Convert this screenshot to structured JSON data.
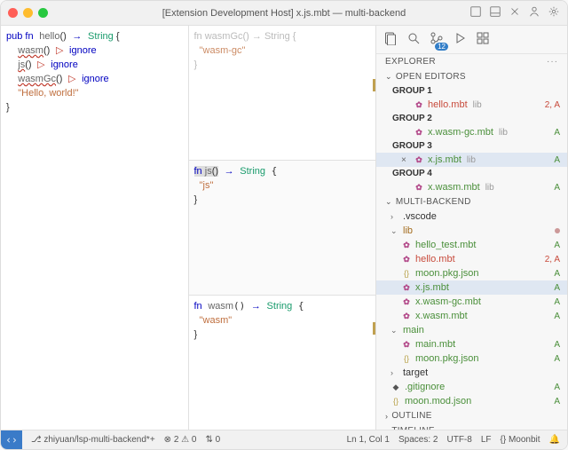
{
  "title": "[Extension Development Host] x.js.mbt — multi-backend",
  "editor_left": {
    "line1_kw": "pub fn",
    "line1_name": "hello",
    "line1_paren": "()",
    "line1_arrow": "→",
    "line1_type": "String",
    "line1_brace": " {",
    "line2_call": "wasm",
    "line2_paren": "()",
    "line2_op": "▷",
    "line2_ignore": "ignore",
    "line3_call": "js",
    "line3_paren": "()",
    "line3_op": "▷",
    "line3_ignore": "ignore",
    "line4_call": "wasmGc",
    "line4_paren": "()",
    "line4_op": "▷",
    "line4_ignore": "ignore",
    "line5_str": "\"Hello, world!\"",
    "line6_brace": "}"
  },
  "pane_gc": {
    "sig": "fn wasmGc() → String {",
    "body": "  \"wasm-gc\"",
    "close": "}"
  },
  "pane_js": {
    "sig": "fn js() → String {",
    "body": "  \"js\"",
    "close": "}"
  },
  "pane_wasm": {
    "sig": "fn wasm() → String {",
    "body": "  \"wasm\"",
    "close": "}"
  },
  "sidebar": {
    "explorer": "EXPLORER",
    "open_editors": "OPEN EDITORS",
    "groups": [
      {
        "name": "GROUP 1",
        "file": "hello.mbt",
        "suffix": "lib",
        "badge": "2, A",
        "kind": "error",
        "icon": "mbt"
      },
      {
        "name": "GROUP 2",
        "file": "x.wasm-gc.mbt",
        "suffix": "lib",
        "badge": "A",
        "kind": "git-a",
        "icon": "mbt"
      },
      {
        "name": "GROUP 3",
        "file": "x.js.mbt",
        "suffix": "lib",
        "badge": "A",
        "kind": "git-a",
        "icon": "mbt",
        "active": true,
        "close": "×"
      },
      {
        "name": "GROUP 4",
        "file": "x.wasm.mbt",
        "suffix": "lib",
        "badge": "A",
        "kind": "git-a",
        "icon": "mbt"
      }
    ],
    "project": "MULTI-BACKEND",
    "tree": [
      {
        "name": ".vscode",
        "type": "folder",
        "chev": "›",
        "level": 1
      },
      {
        "name": "lib",
        "type": "folder",
        "chev": "⌄",
        "level": 1,
        "dot": true,
        "kind": "git-m"
      },
      {
        "name": "hello_test.mbt",
        "type": "file",
        "icon": "mbt",
        "level": 2,
        "badge": "A",
        "kind": "git-a"
      },
      {
        "name": "hello.mbt",
        "type": "file",
        "icon": "mbt",
        "level": 2,
        "badge": "2, A",
        "kind": "error"
      },
      {
        "name": "moon.pkg.json",
        "type": "file",
        "icon": "json",
        "level": 2,
        "badge": "A",
        "kind": "git-a"
      },
      {
        "name": "x.js.mbt",
        "type": "file",
        "icon": "mbt",
        "level": 2,
        "badge": "A",
        "kind": "git-a",
        "active": true
      },
      {
        "name": "x.wasm-gc.mbt",
        "type": "file",
        "icon": "mbt",
        "level": 2,
        "badge": "A",
        "kind": "git-a"
      },
      {
        "name": "x.wasm.mbt",
        "type": "file",
        "icon": "mbt",
        "level": 2,
        "badge": "A",
        "kind": "git-a"
      },
      {
        "name": "main",
        "type": "folder",
        "chev": "⌄",
        "level": 1,
        "kind": "git-a"
      },
      {
        "name": "main.mbt",
        "type": "file",
        "icon": "mbt",
        "level": 2,
        "badge": "A",
        "kind": "git-a"
      },
      {
        "name": "moon.pkg.json",
        "type": "file",
        "icon": "json",
        "level": 2,
        "badge": "A",
        "kind": "git-a"
      },
      {
        "name": "target",
        "type": "folder",
        "chev": "›",
        "level": 1
      },
      {
        "name": ".gitignore",
        "type": "file",
        "icon": "git",
        "level": 1,
        "badge": "A",
        "kind": "git-a"
      },
      {
        "name": "moon.mod.json",
        "type": "file",
        "icon": "json",
        "level": 1,
        "badge": "A",
        "kind": "git-a"
      }
    ],
    "outline": "OUTLINE",
    "timeline": "TIMELINE"
  },
  "statusbar": {
    "branch": "zhiyuan/lsp-multi-backend*+",
    "errors": "2",
    "warnings": "0",
    "ports": "0",
    "cursor": "Ln 1, Col 1",
    "spaces": "Spaces: 2",
    "encoding": "UTF-8",
    "eol": "LF",
    "lang": "{} Moonbit"
  }
}
